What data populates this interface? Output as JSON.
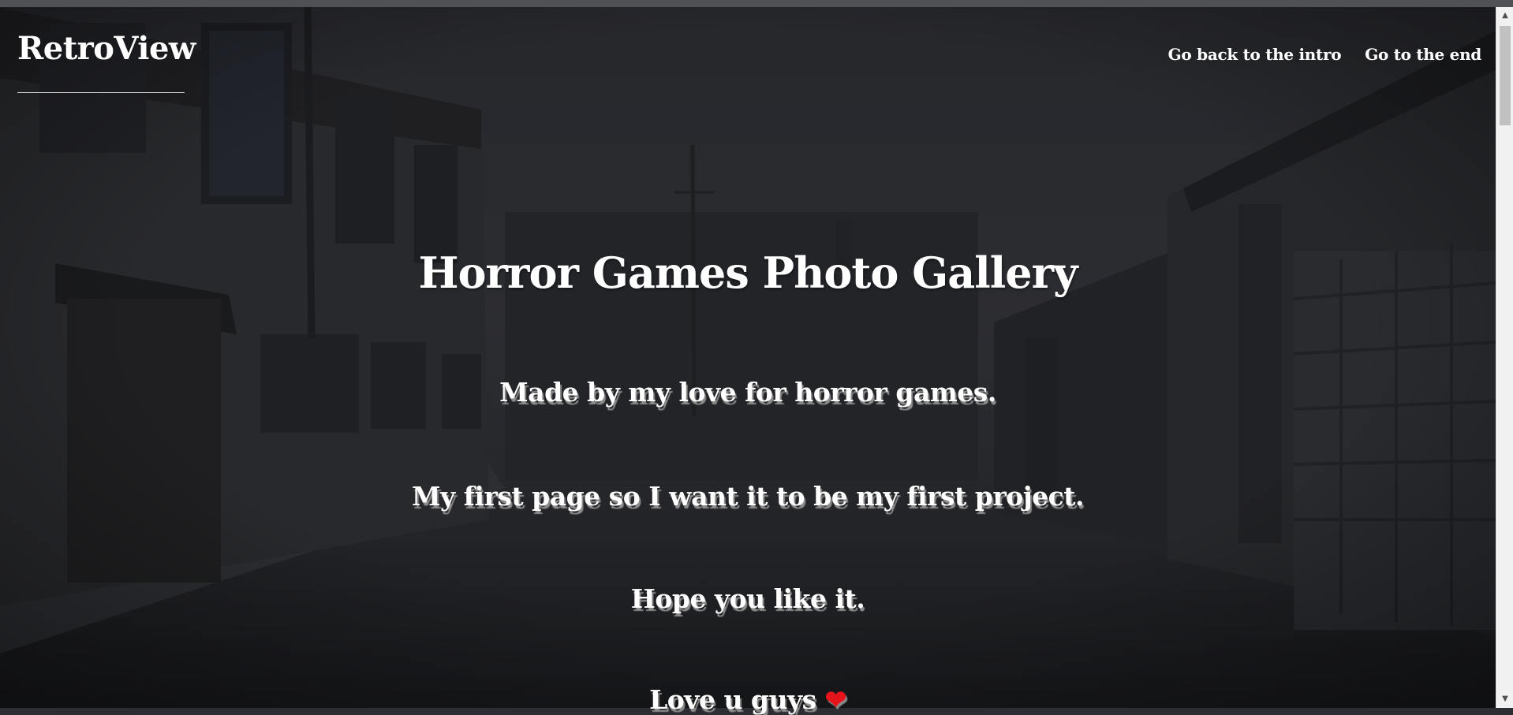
{
  "header": {
    "brand": "RetroView",
    "nav": [
      {
        "label": "Go back to the intro"
      },
      {
        "label": "Go to the end"
      }
    ]
  },
  "hero": {
    "title": "Horror Games Photo Gallery",
    "lines": [
      "Made by my love for horror games.",
      "My first page so I want it to be my first project.",
      "Hope you like it.",
      "Love u guys"
    ],
    "heart": "❤"
  },
  "colors": {
    "text": "#ffffff",
    "heart": "#e5141b",
    "background": "#2b2d32"
  }
}
